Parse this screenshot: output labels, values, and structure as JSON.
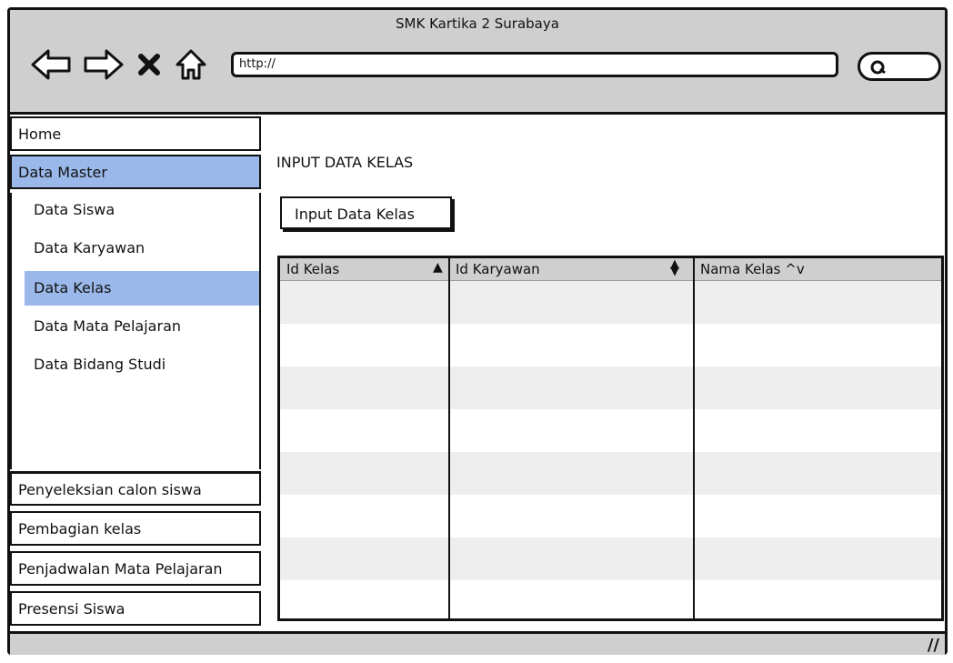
{
  "window": {
    "title": "SMK Kartika 2 Surabaya"
  },
  "nav": {
    "back_icon": "back-arrow-icon",
    "forward_icon": "forward-arrow-icon",
    "stop_icon": "close-icon",
    "home_icon": "home-icon"
  },
  "url_bar": {
    "value": "http://"
  },
  "search": {
    "icon": "search-icon"
  },
  "sidebar": {
    "home": "Home",
    "data_master": "Data Master",
    "submenu": [
      "Data Siswa",
      "Data Karyawan",
      "Data Kelas",
      "Data Mata Pelajaran",
      "Data Bidang Studi"
    ],
    "active_submenu": "Data Kelas",
    "bottom_items": [
      "Penyeleksian calon siswa",
      "Pembagian kelas",
      "Penjadwalan Mata Pelajaran",
      "Presensi Siswa"
    ]
  },
  "main": {
    "title": "INPUT DATA KELAS",
    "input_button": "Input Data Kelas",
    "table": {
      "columns": [
        "Id Kelas",
        "Id Karyawan",
        "Nama Kelas ^v"
      ],
      "rows": []
    }
  },
  "colors": {
    "chrome": "#cfcfcf",
    "highlight": "#9ab9ea",
    "row_alt": "#eeeeee"
  }
}
